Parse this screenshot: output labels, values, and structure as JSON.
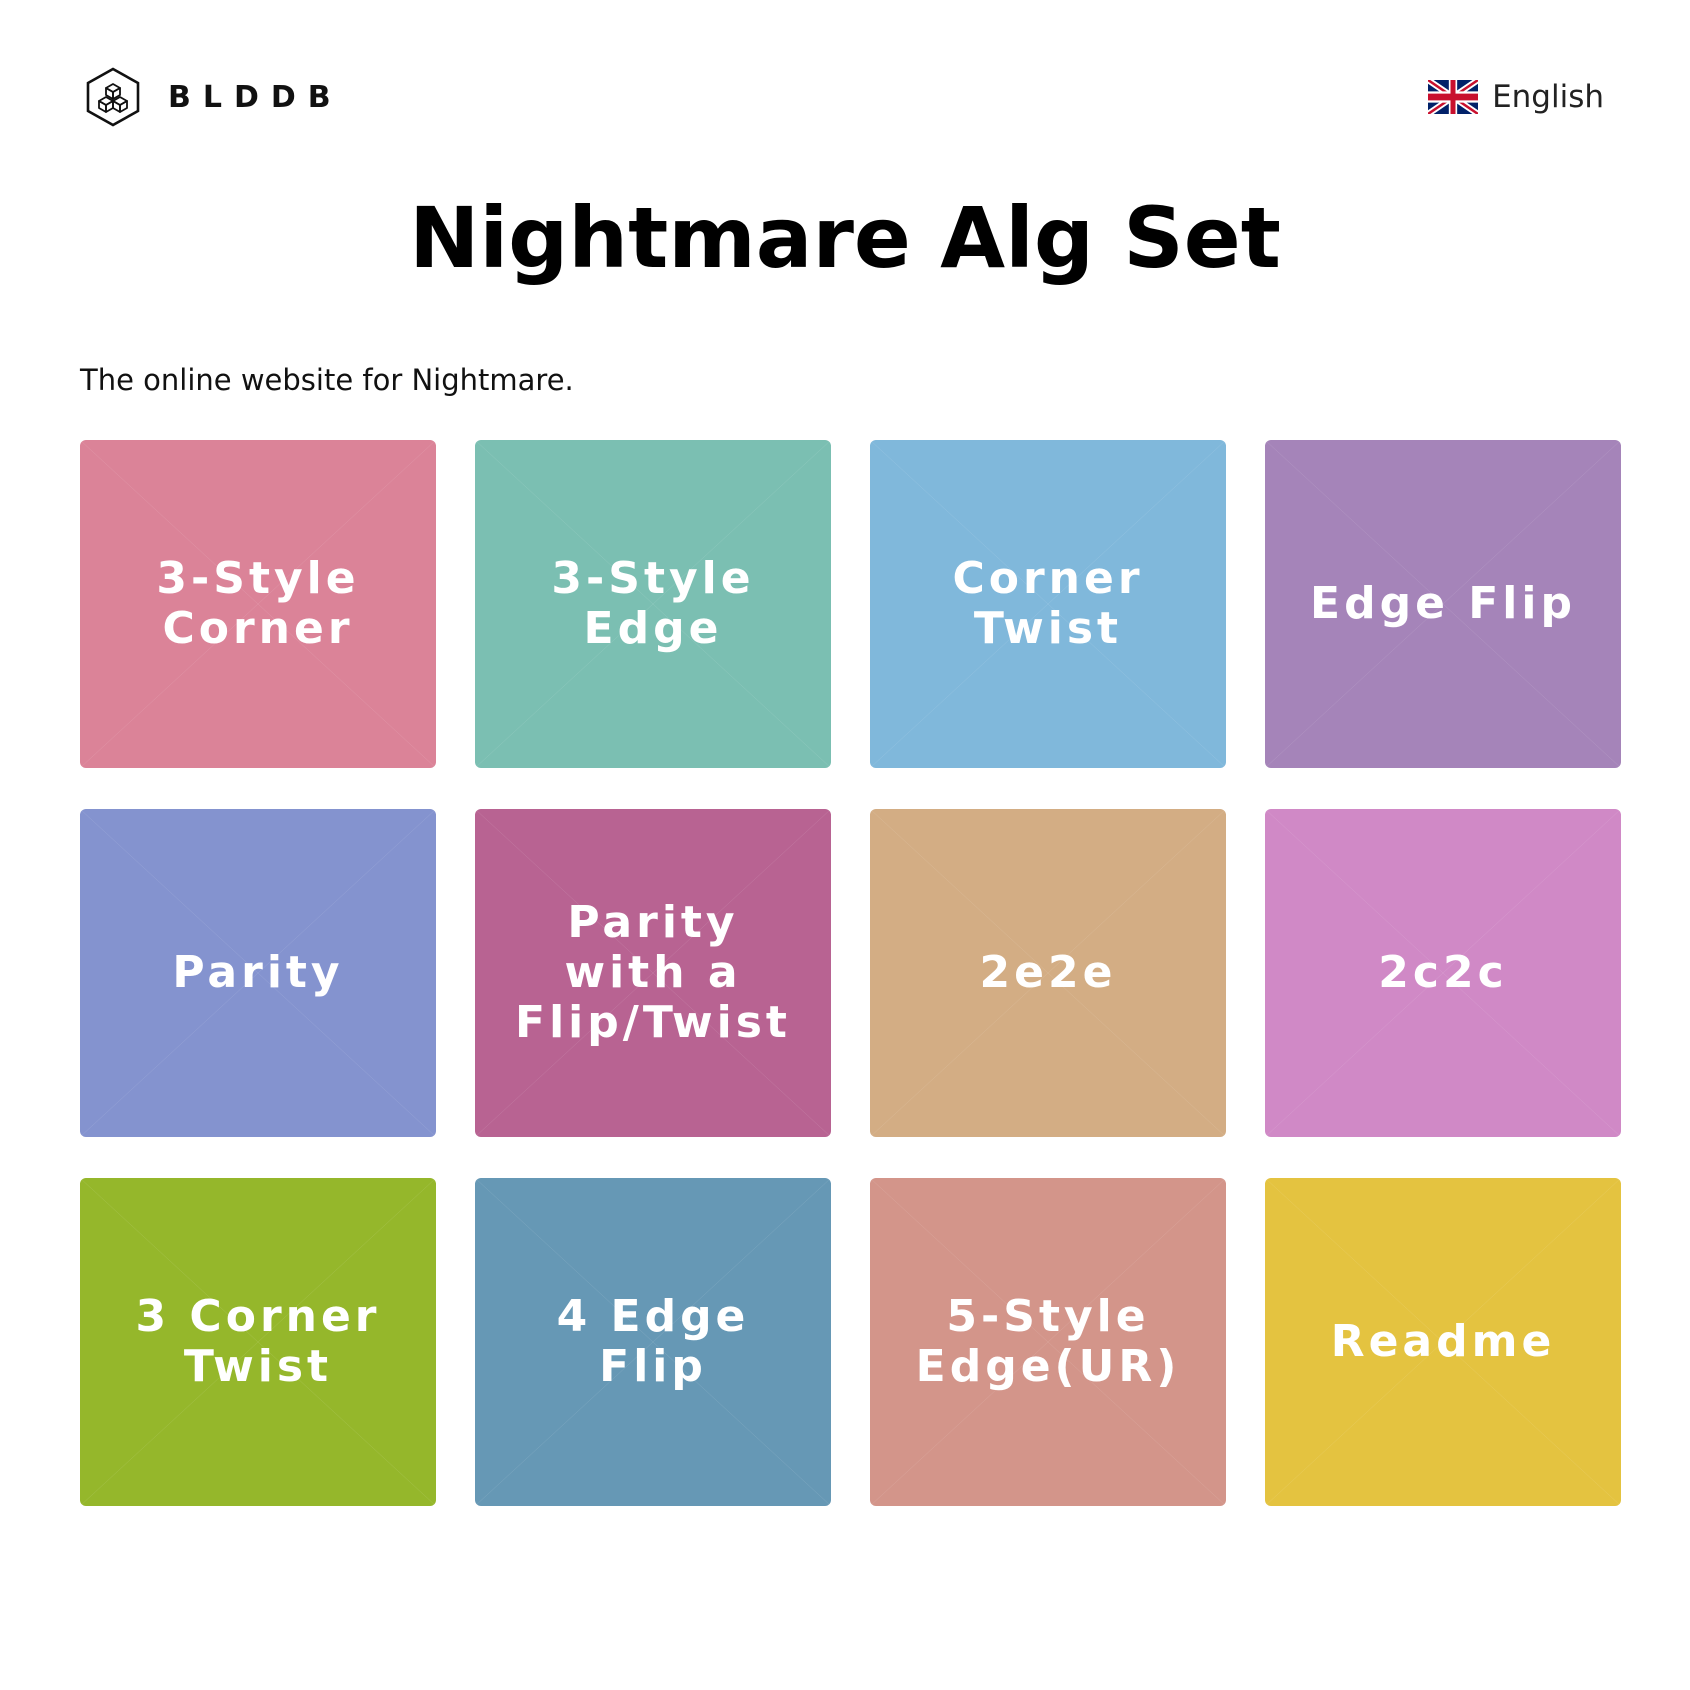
{
  "brand": {
    "name": "BLDDB",
    "logo_icon": "cube-hexagon-icon"
  },
  "language": {
    "label": "English",
    "flag_icon": "uk-flag-icon"
  },
  "page": {
    "title": "Nightmare Alg Set",
    "intro": "The online website for Nightmare."
  },
  "tiles": [
    {
      "label": "3-Style Corner",
      "color": "#db8398"
    },
    {
      "label": "3-Style Edge",
      "color": "#7bbfb2"
    },
    {
      "label": "Corner Twist",
      "color": "#80b8db"
    },
    {
      "label": "Edge Flip",
      "color": "#a584b9"
    },
    {
      "label": "Parity",
      "color": "#8493cf"
    },
    {
      "label": "Parity with a Flip/Twist",
      "color": "#b86392"
    },
    {
      "label": "2e2e",
      "color": "#d3ad84"
    },
    {
      "label": "2c2c",
      "color": "#d089c6"
    },
    {
      "label": "3 Corner Twist",
      "color": "#95b72b"
    },
    {
      "label": "4 Edge Flip",
      "color": "#6698b5"
    },
    {
      "label": "5-Style Edge(UR)",
      "color": "#d3958a"
    },
    {
      "label": "Readme",
      "color": "#e4c340"
    }
  ]
}
